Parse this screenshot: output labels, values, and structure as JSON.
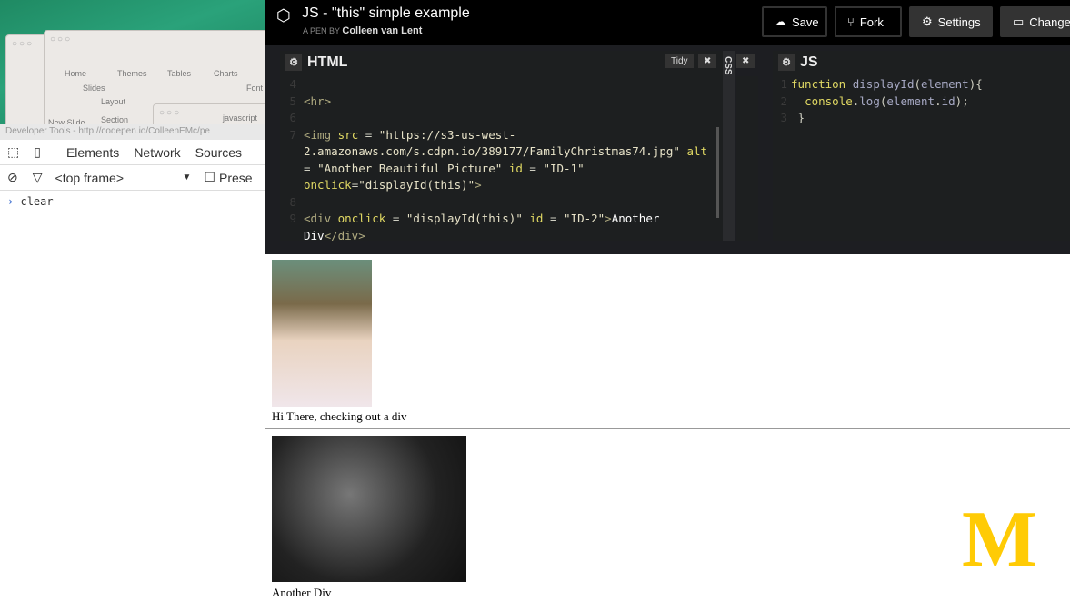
{
  "desktop": {
    "ribbon_tabs": [
      "Home",
      "Themes",
      "Tables",
      "Charts"
    ],
    "ribbon_group": "Slides",
    "font_group": "Font",
    "layout": "Layout",
    "section": "Section",
    "new_slide": "New Slide",
    "browser_tab": "javascript"
  },
  "devtools": {
    "title": "Developer Tools - http://codepen.io/ColleenEMc/pe",
    "tabs": [
      "Elements",
      "Network",
      "Sources"
    ],
    "frame": "<top frame>",
    "preserve": "Prese",
    "console_line": "clear"
  },
  "codepen": {
    "title": "JS - \"this\" simple example",
    "byline_prefix": "A PEN BY",
    "author": "Colleen van Lent",
    "buttons": {
      "save": "Save",
      "fork": "Fork",
      "settings": "Settings",
      "change": "Change"
    },
    "html_panel": {
      "label": "HTML",
      "tidy": "Tidy",
      "close": "✖"
    },
    "css_panel": {
      "label": "CSS",
      "close": "✖"
    },
    "js_panel": {
      "label": "JS"
    },
    "html_line_numbers": [
      "4",
      "5",
      "6",
      "7",
      "8",
      "9"
    ],
    "js_line_numbers": [
      "1",
      "2",
      "3"
    ]
  },
  "preview": {
    "caption1": "Hi There, checking out a div",
    "caption2": "Another Div"
  },
  "brand": {
    "logo_letter": "M",
    "logo_color": "#FFCB05"
  }
}
